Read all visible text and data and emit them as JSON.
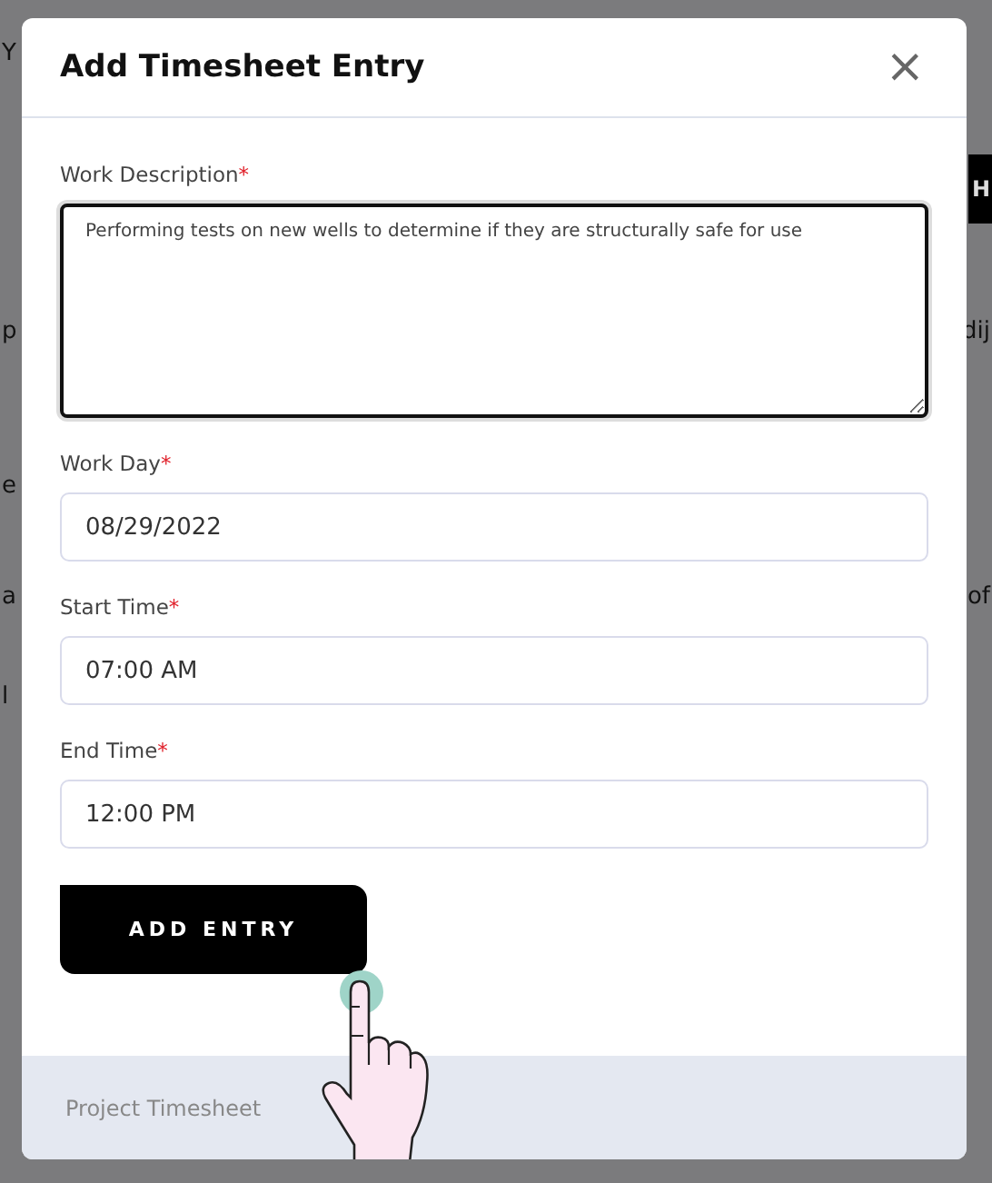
{
  "background": {
    "rows": [
      {
        "left": "Y"
      },
      {
        "button": "H"
      },
      {
        "left": "p",
        "right": "dij"
      },
      {
        "left": "e"
      },
      {
        "left": "a",
        "right": "of"
      },
      {
        "left": "l"
      }
    ]
  },
  "modal": {
    "title": "Add Timesheet Entry",
    "close": "×",
    "required_mark": "*",
    "fields": [
      {
        "kind": "textarea",
        "label": "Work Description",
        "required": true,
        "value": "Performing tests on new wells to determine if they are structurally safe for use"
      },
      {
        "kind": "input",
        "label": "Work Day",
        "required": true,
        "value": "08/29/2022"
      },
      {
        "kind": "input",
        "label": "Start Time",
        "required": true,
        "value": "07:00 AM"
      },
      {
        "kind": "input",
        "label": "End Time",
        "required": true,
        "value": "12:00 PM"
      }
    ],
    "submit": "ADD ENTRY",
    "footer": "Project Timesheet"
  }
}
